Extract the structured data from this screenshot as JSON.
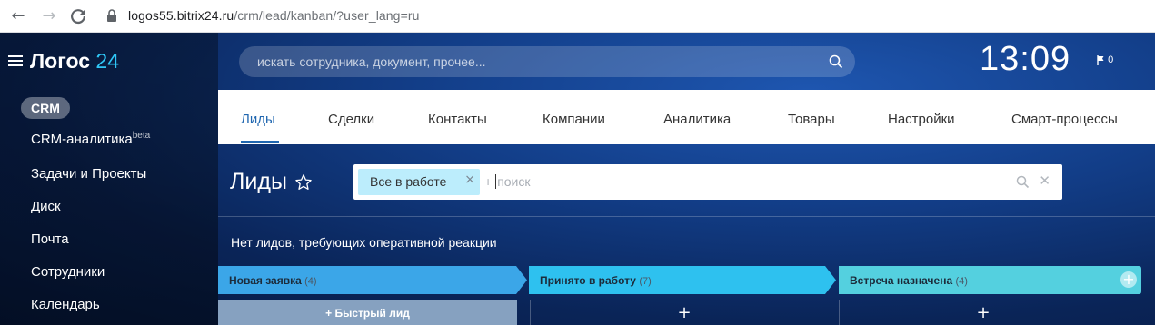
{
  "browser": {
    "url_host": "logos55.bitrix24.ru",
    "url_path": "/crm/lead/kanban/?user_lang=ru"
  },
  "sidebar": {
    "logo_name": "Логос",
    "logo_num": "24",
    "items": [
      {
        "label": "CRM"
      },
      {
        "label": "CRM-аналитика",
        "badge": "beta"
      },
      {
        "label": "Задачи и Проекты"
      },
      {
        "label": "Диск"
      },
      {
        "label": "Почта"
      },
      {
        "label": "Сотрудники"
      },
      {
        "label": "Календарь"
      }
    ]
  },
  "header": {
    "search_placeholder": "искать сотрудника, документ, прочее...",
    "clock": "13:09",
    "flag_count": "0"
  },
  "tabs": [
    {
      "label": "Лиды",
      "active": true
    },
    {
      "label": "Сделки"
    },
    {
      "label": "Контакты"
    },
    {
      "label": "Компании"
    },
    {
      "label": "Аналитика"
    },
    {
      "label": "Товары"
    },
    {
      "label": "Настройки"
    },
    {
      "label": "Смарт-процессы"
    }
  ],
  "page": {
    "title": "Лиды",
    "filter_chip": "Все в работе",
    "filter_placeholder_prefix": "+",
    "filter_placeholder": "поиск",
    "notice": "Нет лидов, требующих оперативной реакции"
  },
  "kanban": {
    "columns": [
      {
        "name": "Новая заявка",
        "count": "(4)",
        "color": "#3ba6e8"
      },
      {
        "name": "Принято в работу",
        "count": "(7)",
        "color": "#2ec1ef"
      },
      {
        "name": "Встреча назначена",
        "count": "(4)",
        "color": "#54d0df"
      }
    ],
    "quick_lead_label": "+ Быстрый лид",
    "add_symbol": "+"
  },
  "colors": {
    "accent": "#2067b0",
    "chip_bg": "#bcedfc"
  }
}
